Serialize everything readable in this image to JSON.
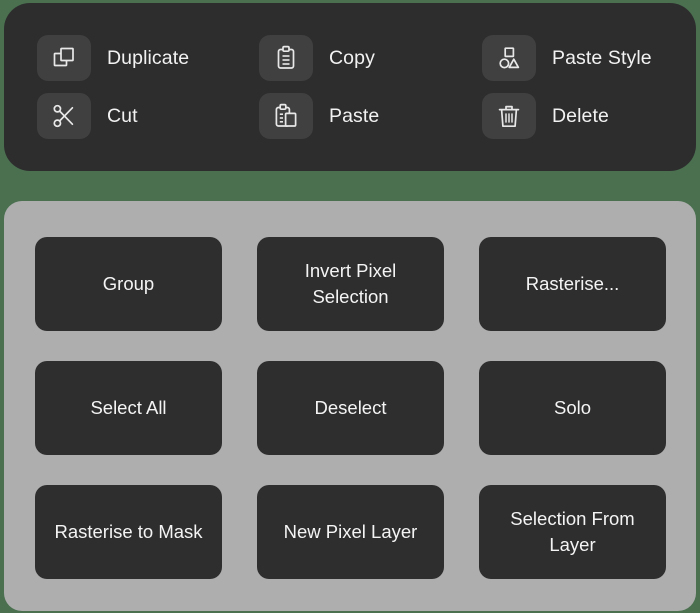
{
  "colors": {
    "background": "#4a7050",
    "top_panel": "#2d2d2d",
    "icon_tile": "#404040",
    "bottom_panel": "#aeaeae",
    "action_button": "#2e2e2e",
    "text": "#f2f2f2"
  },
  "context_menu": {
    "items": [
      {
        "label": "Duplicate",
        "icon": "duplicate-icon"
      },
      {
        "label": "Copy",
        "icon": "clipboard-copy-icon"
      },
      {
        "label": "Paste Style",
        "icon": "shapes-paste-style-icon"
      },
      {
        "label": "Cut",
        "icon": "scissors-icon"
      },
      {
        "label": "Paste",
        "icon": "clipboard-paste-icon"
      },
      {
        "label": "Delete",
        "icon": "trash-icon"
      }
    ]
  },
  "actions_panel": {
    "buttons": [
      {
        "label": "Group"
      },
      {
        "label": "Invert Pixel Selection"
      },
      {
        "label": "Rasterise..."
      },
      {
        "label": "Select All"
      },
      {
        "label": "Deselect"
      },
      {
        "label": "Solo"
      },
      {
        "label": "Rasterise to Mask"
      },
      {
        "label": "New Pixel Layer"
      },
      {
        "label": "Selection From Layer"
      }
    ]
  }
}
